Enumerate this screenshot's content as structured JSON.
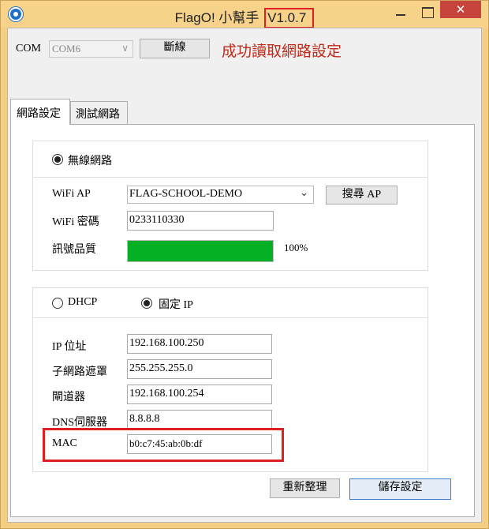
{
  "window": {
    "title": "FlagO! 小幫手",
    "version": "V1.0.7",
    "close_glyph": "✕"
  },
  "toolbar": {
    "com_label": "COM",
    "com_value": "COM6",
    "disconnect_label": "斷線",
    "status_text": "成功讀取網路設定"
  },
  "tabs": {
    "network": "網路設定",
    "test": "測試網路"
  },
  "wifi": {
    "mode_label": "無線網路",
    "ap_label": "WiFi AP",
    "ap_value": "FLAG-SCHOOL-DEMO",
    "search_label": "搜尋 AP",
    "password_label": "WiFi 密碼",
    "password_value": "0233110330",
    "signal_label": "訊號品質",
    "signal_percent": 100,
    "signal_text": "100%",
    "signal_color": "#06b025"
  },
  "ip": {
    "dhcp_label": "DHCP",
    "static_label": "固定 IP",
    "static_selected": true,
    "fields": [
      {
        "label": "IP 位址",
        "value": "192.168.100.250"
      },
      {
        "label": "子網路遮罩",
        "value": "255.255.255.0"
      },
      {
        "label": "閘道器",
        "value": "192.168.100.254"
      },
      {
        "label": "DNS伺服器",
        "value": "8.8.8.8"
      },
      {
        "label": "MAC",
        "value": "b0:c7:45:ab:0b:df"
      }
    ]
  },
  "actions": {
    "reset_label": "重新整理",
    "save_label": "儲存設定"
  },
  "colors": {
    "window_frame": "#f4cf83",
    "status_text": "#c02a1a",
    "highlight": "#e02020",
    "close_button": "#c7443c"
  }
}
